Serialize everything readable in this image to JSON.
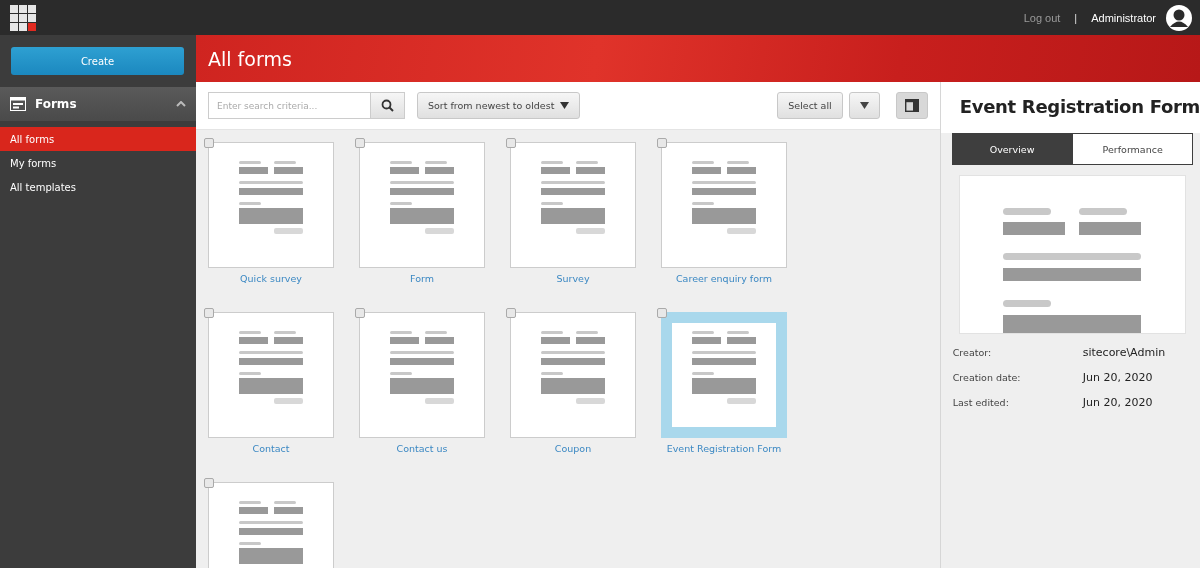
{
  "topbar": {
    "logout": "Log out",
    "separator": "|",
    "user": "Administrator"
  },
  "sidebar": {
    "create": "Create",
    "section": {
      "title": "Forms",
      "expanded": true
    },
    "items": [
      {
        "label": "All forms",
        "selected": true
      },
      {
        "label": "My forms",
        "selected": false
      },
      {
        "label": "All templates",
        "selected": false
      }
    ]
  },
  "header": {
    "title": "All forms"
  },
  "toolbar": {
    "search": {
      "placeholder": "Enter search criteria..."
    },
    "sort": "Sort from newest to oldest",
    "select_all": "Select all",
    "panel_toggle": {
      "on": true
    }
  },
  "forms": [
    {
      "name": "Quick survey",
      "selected": false,
      "checked": false
    },
    {
      "name": "Form",
      "selected": false,
      "checked": false
    },
    {
      "name": "Survey",
      "selected": false,
      "checked": false
    },
    {
      "name": "Career enquiry form",
      "selected": false,
      "checked": false
    },
    {
      "name": "Contact",
      "selected": false,
      "checked": false
    },
    {
      "name": "Contact us",
      "selected": false,
      "checked": false
    },
    {
      "name": "Coupon",
      "selected": false,
      "checked": false
    },
    {
      "name": "Event Registration Form",
      "selected": true,
      "checked": false
    },
    {
      "selected": false,
      "checked": false
    }
  ],
  "details": {
    "title": "Event Registration Form",
    "tabs": [
      {
        "label": "Overview",
        "selected": true
      },
      {
        "label": "Performance",
        "selected": false
      }
    ],
    "fields": [
      {
        "label": "Creator:",
        "value": "sitecore\\Admin"
      },
      {
        "label": "Creation date:",
        "value": "Jun 20, 2020"
      },
      {
        "label": "Last edited:",
        "value": "Jun 20, 2020"
      }
    ]
  }
}
